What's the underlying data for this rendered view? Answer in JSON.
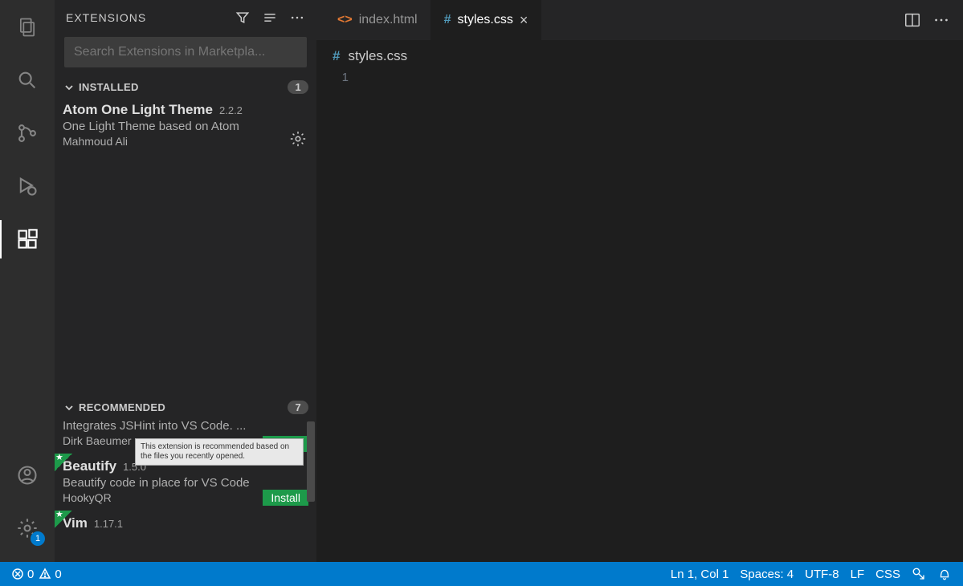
{
  "activityBar": {
    "settingsBadge": "1"
  },
  "sidebar": {
    "title": "EXTENSIONS",
    "searchPlaceholder": "Search Extensions in Marketpla...",
    "installed": {
      "label": "INSTALLED",
      "count": "1",
      "items": [
        {
          "name": "Atom One Light Theme",
          "version": "2.2.2",
          "desc": "One Light Theme based on Atom",
          "author": "Mahmoud Ali"
        }
      ]
    },
    "recommended": {
      "label": "RECOMMENDED",
      "count": "7",
      "tooltip": "This extension is recommended based on the files you recently opened.",
      "items": [
        {
          "desc": "Integrates JSHint into VS Code. ...",
          "author": "Dirk Baeumer",
          "installLabel": "Install"
        },
        {
          "name": "Beautify",
          "version": "1.5.0",
          "desc": "Beautify code in place for VS Code",
          "author": "HookyQR",
          "installLabel": "Install"
        },
        {
          "name": "Vim",
          "version": "1.17.1"
        }
      ]
    }
  },
  "tabs": {
    "items": [
      {
        "label": "index.html",
        "iconType": "html",
        "active": false
      },
      {
        "label": "styles.css",
        "iconType": "css",
        "active": true
      }
    ]
  },
  "breadcrumb": {
    "file": "styles.css"
  },
  "editor": {
    "lineNumber": "1"
  },
  "statusBar": {
    "errors": "0",
    "warnings": "0",
    "cursor": "Ln 1, Col 1",
    "spaces": "Spaces: 4",
    "encoding": "UTF-8",
    "eol": "LF",
    "lang": "CSS"
  }
}
